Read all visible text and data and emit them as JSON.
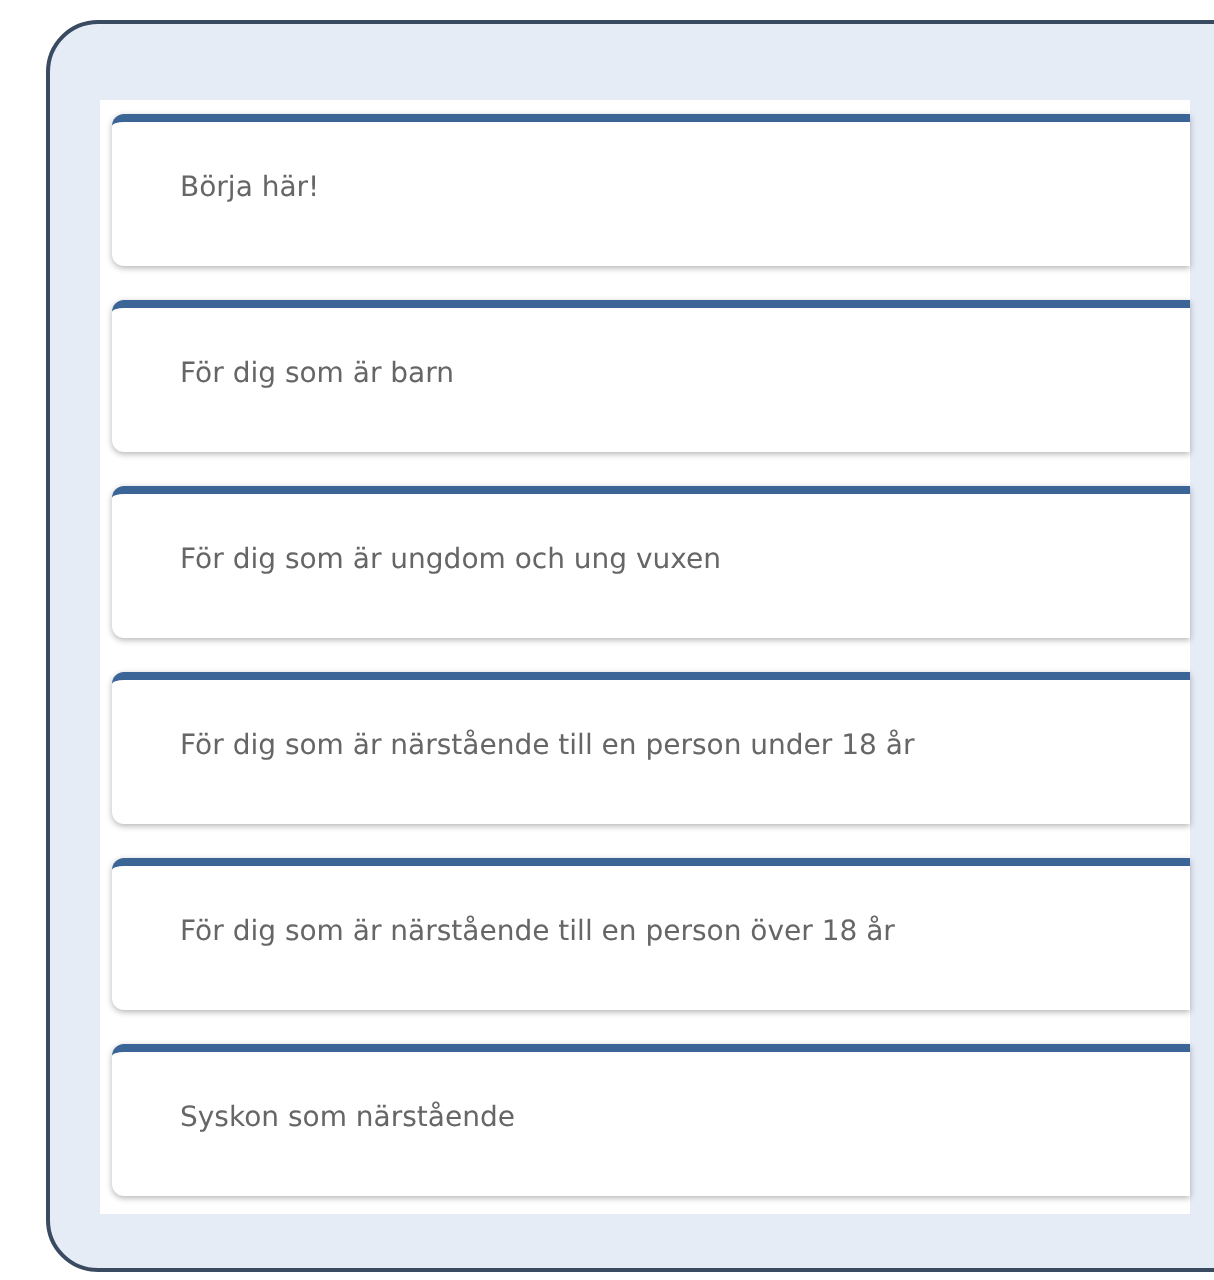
{
  "cards": [
    {
      "label": "Börja här!"
    },
    {
      "label": "För dig som är barn"
    },
    {
      "label": "För dig som är ungdom och ung vuxen"
    },
    {
      "label": "För dig som är närstående till en person under 18 år"
    },
    {
      "label": "För dig som är närstående till en person över 18 år"
    },
    {
      "label": "Syskon som närstående"
    }
  ]
}
